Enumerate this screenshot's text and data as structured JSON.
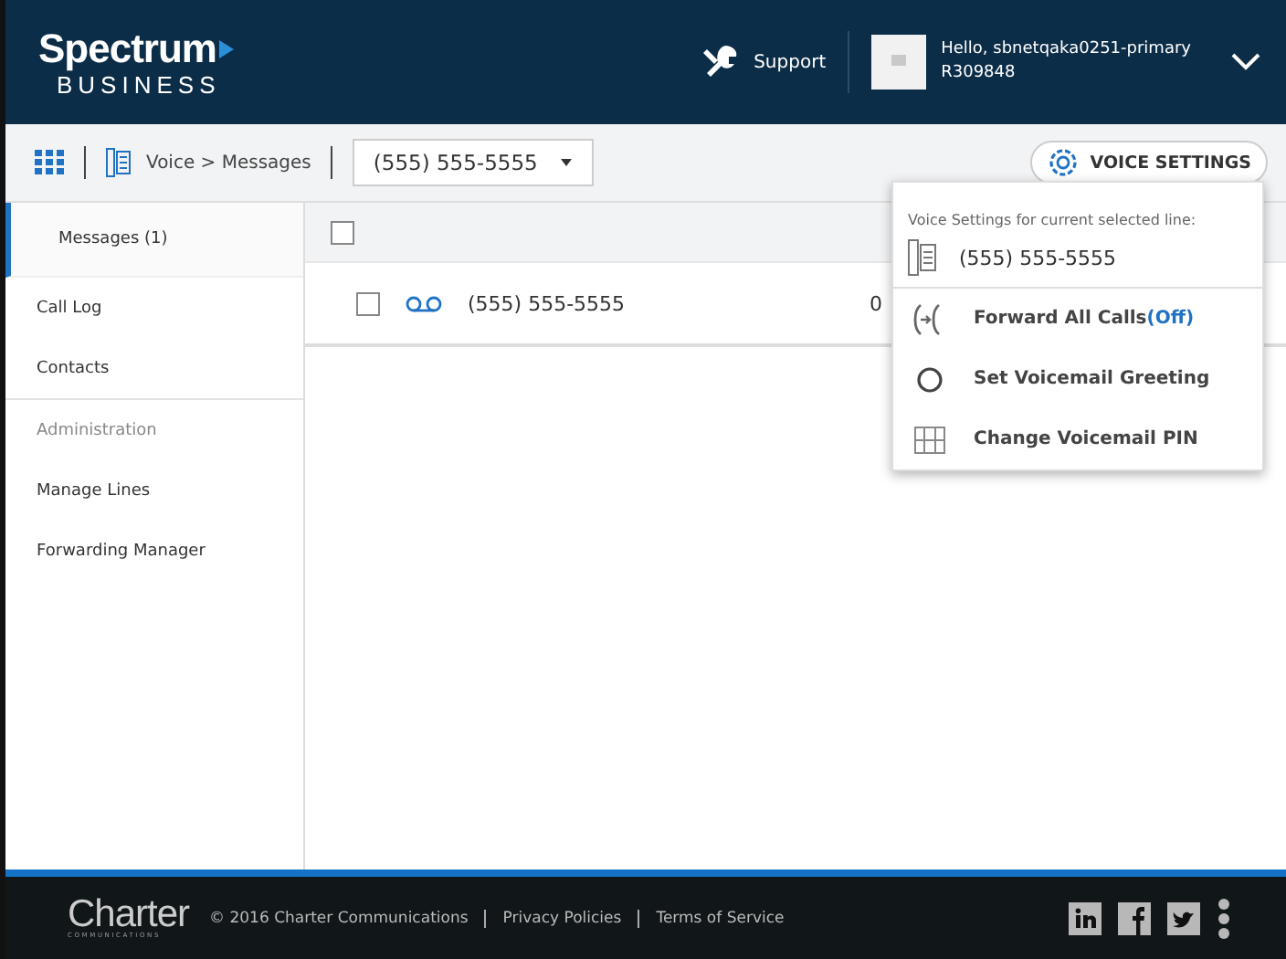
{
  "header": {
    "logo": {
      "name": "Spectrum",
      "sub": "BUSINESS"
    },
    "support": "Support",
    "greeting": "Hello, sbnetqaka0251-primary",
    "account": "R309848"
  },
  "toolbar": {
    "breadcrumb": [
      "Voice",
      ">",
      "Messages"
    ],
    "line": "(555) 555-5555",
    "voice_settings": "VOICE SETTINGS"
  },
  "sidebar": {
    "items": [
      {
        "label": "Messages (1)",
        "kind": "item",
        "selected": true
      },
      {
        "label": "Call Log",
        "kind": "item",
        "selected": false
      },
      {
        "label": "Contacts",
        "kind": "item",
        "selected": false
      },
      {
        "label": "Administration",
        "kind": "header",
        "selected": false
      },
      {
        "label": "Manage Lines",
        "kind": "item",
        "selected": false
      },
      {
        "label": "Forwarding Manager",
        "kind": "item",
        "selected": false
      }
    ]
  },
  "table": {
    "header_checked": false,
    "rows": [
      {
        "checked": false,
        "number": "(555) 555-5555",
        "column_3": "0"
      }
    ]
  },
  "menu": {
    "caption": "Voice Settings for current selected line:",
    "line": "(555) 555-5555",
    "items": [
      {
        "kind": "forward",
        "label": "Forward All Calls",
        "status": "(Off)"
      },
      {
        "kind": "greeting",
        "label": "Set Voicemail Greeting"
      },
      {
        "kind": "pin",
        "label": "Change Voicemail PIN"
      }
    ]
  },
  "footer": {
    "logo": {
      "name": "Charter",
      "sub": "COMMUNICATIONS"
    },
    "copyright": "© 2016 Charter Communications",
    "links": [
      "Privacy Policies",
      "Terms of Service"
    ]
  }
}
